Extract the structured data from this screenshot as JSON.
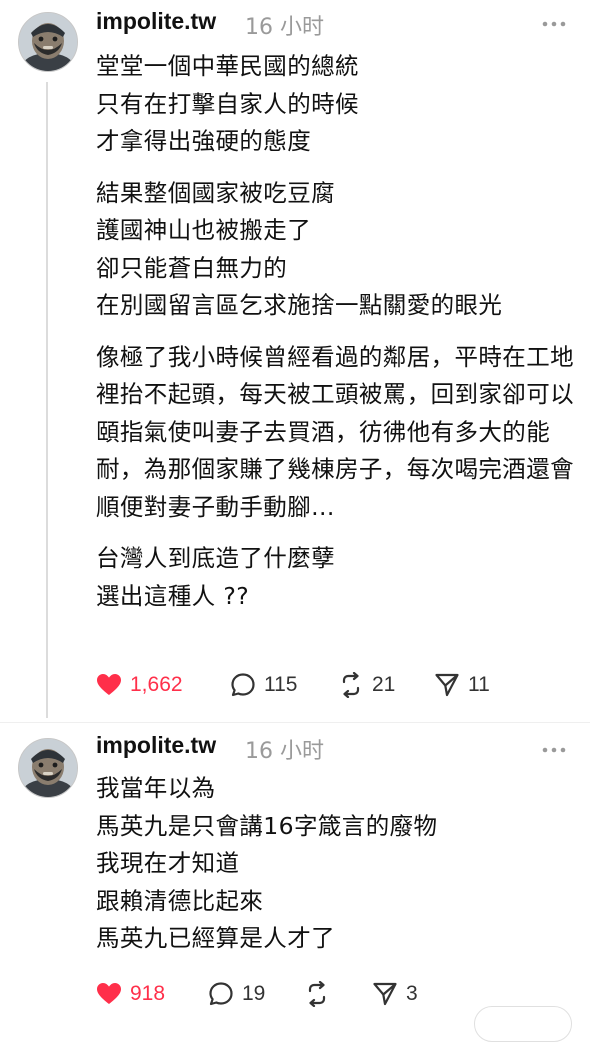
{
  "posts": [
    {
      "username": "impolite.tw",
      "time": "16 小时",
      "paragraphs": [
        "堂堂一個中華民國的總統\n只有在打擊自家人的時候\n才拿得出強硬的態度",
        "結果整個國家被吃豆腐\n護國神山也被搬走了\n卻只能蒼白無力的\n在別國留言區乞求施捨一點關愛的眼光",
        "像極了我小時候曾經看過的鄰居，平時在工地裡抬不起頭，每天被工頭被罵，回到家卻可以頤指氣使叫妻子去買酒，彷彿他有多大的能耐，為那個家賺了幾棟房子，每次喝完酒還會順便對妻子動手動腳...",
        "台灣人到底造了什麼孽\n選出這種人 ??"
      ],
      "likes": "1,662",
      "replies": "115",
      "reposts": "21",
      "shares": "11"
    },
    {
      "username": "impolite.tw",
      "time": "16 小时",
      "paragraphs": [
        "我當年以為\n馬英九是只會講16字箴言的廢物\n我現在才知道\n跟賴清德比起來\n馬英九已經算是人才了"
      ],
      "likes": "918",
      "replies": "19",
      "reposts": "",
      "shares": "3"
    }
  ],
  "icons": {
    "like": "heart-icon",
    "reply": "comment-icon",
    "repost": "repost-icon",
    "share": "share-icon",
    "more": "more-icon"
  },
  "colors": {
    "like_active": "#ff2f4a",
    "meta": "#9a9a9a",
    "text": "#111111"
  }
}
